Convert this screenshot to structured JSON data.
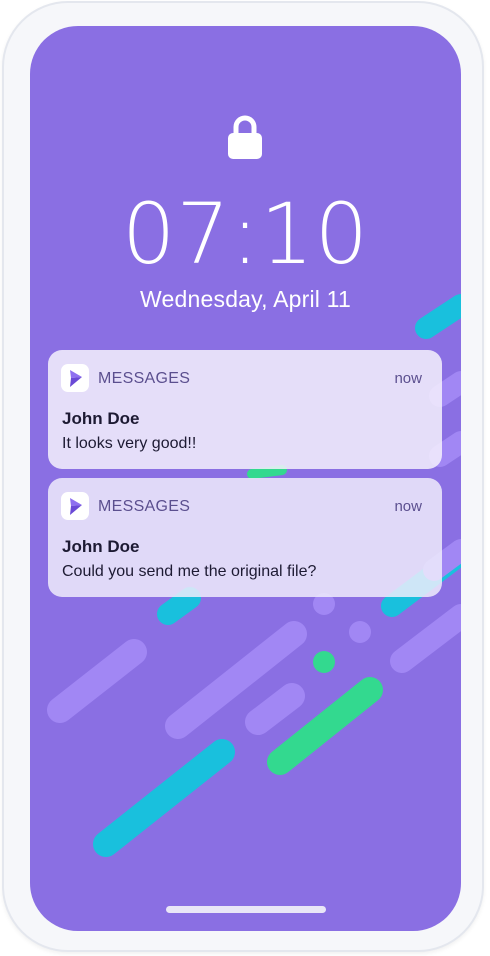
{
  "lock_screen": {
    "time": "07:10",
    "date": "Wednesday, April 11"
  },
  "notifications": [
    {
      "app": "MESSAGES",
      "time": "now",
      "sender": "John Doe",
      "message": "It looks very good!!"
    },
    {
      "app": "MESSAGES",
      "time": "now",
      "sender": "John Doe",
      "message": "Could you send me the original file?"
    }
  ],
  "icons": {
    "lock": "lock-icon",
    "app": "messages-app-icon"
  },
  "colors": {
    "background": "#8a6fe3",
    "accent_light_purple": "#a48af7",
    "accent_cyan": "#19c0dd",
    "accent_green": "#33d98f",
    "app_icon": "#7b5be0"
  }
}
